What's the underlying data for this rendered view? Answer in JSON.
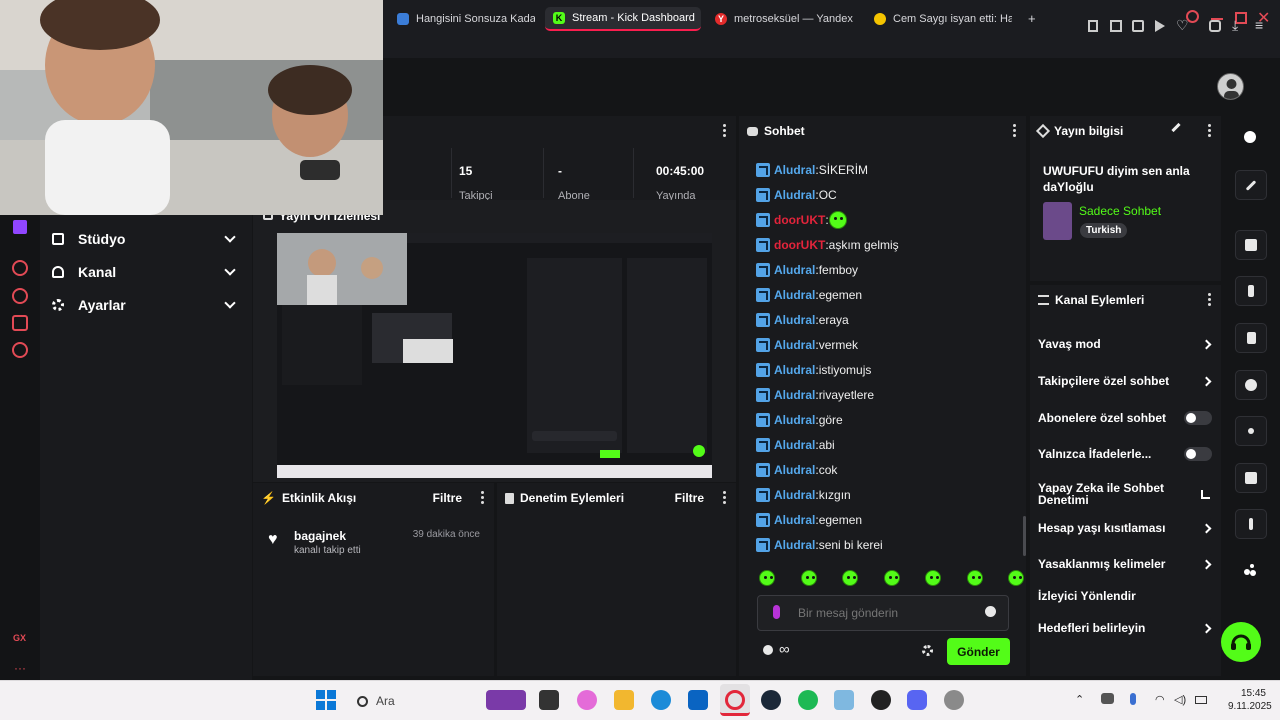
{
  "browser": {
    "tabs": [
      {
        "label": "Hangisini Sonsuza Kadar",
        "color": "#3b7dd8"
      },
      {
        "label": "Stream - Kick Dashboard",
        "color": "#53fc18"
      },
      {
        "label": "metroseksüel — Yandex",
        "color": "#e32b2b"
      },
      {
        "label": "Cem Saygı isyan etti: Hay",
        "color": "#f5c400"
      }
    ],
    "new_tab": "+"
  },
  "leftnav": {
    "items": [
      {
        "label": "Stüdyo"
      },
      {
        "label": "Kanal"
      },
      {
        "label": "Ayarlar"
      }
    ],
    "footer": "GX"
  },
  "stats": {
    "values": [
      "15",
      "-",
      "00:45:00"
    ],
    "labels": [
      "Takipçi",
      "Abone",
      "Yayında"
    ]
  },
  "preview": {
    "title": "Yayın Ön İzlemesi"
  },
  "activity": {
    "title": "Etkinlik Akışı",
    "filter": "Filtre",
    "item": {
      "user": "bagajnek",
      "text": "kanalı takip etti",
      "time": "39 dakika önce"
    }
  },
  "moderation": {
    "title": "Denetim Eylemleri",
    "filter": "Filtre"
  },
  "chat": {
    "title": "Sohbet",
    "messages": [
      {
        "user": "Aludral",
        "text": "SİKERİM",
        "color": "blue"
      },
      {
        "user": "Aludral",
        "text": "OC",
        "color": "blue"
      },
      {
        "user": "doorUKT",
        "text": "",
        "color": "red",
        "emote": true
      },
      {
        "user": "doorUKT",
        "text": "aşkım gelmiş",
        "color": "red"
      },
      {
        "user": "Aludral",
        "text": "femboy",
        "color": "blue"
      },
      {
        "user": "Aludral",
        "text": "egemen",
        "color": "blue"
      },
      {
        "user": "Aludral",
        "text": "eraya",
        "color": "blue"
      },
      {
        "user": "Aludral",
        "text": "vermek",
        "color": "blue"
      },
      {
        "user": "Aludral",
        "text": "istiyomujs",
        "color": "blue"
      },
      {
        "user": "Aludral",
        "text": "rivayetlere",
        "color": "blue"
      },
      {
        "user": "Aludral",
        "text": "göre",
        "color": "blue"
      },
      {
        "user": "Aludral",
        "text": "abi",
        "color": "blue"
      },
      {
        "user": "Aludral",
        "text": "cok",
        "color": "blue"
      },
      {
        "user": "Aludral",
        "text": "kızgın",
        "color": "blue"
      },
      {
        "user": "Aludral",
        "text": "egemen",
        "color": "blue"
      },
      {
        "user": "Aludral",
        "text": "seni bi kerei",
        "color": "blue"
      }
    ],
    "placeholder": "Bir mesaj gönderin",
    "send": "Gönder"
  },
  "stream_info": {
    "title": "Yayın bilgisi",
    "stream_title": "UWUFUFU diyim sen anla daYloğlu",
    "category": "Sadece Sohbet",
    "language": "Turkish"
  },
  "channel_actions": {
    "title": "Kanal Eylemleri",
    "items": [
      {
        "label": "Yavaş mod",
        "control": "chevron"
      },
      {
        "label": "Takipçilere özel sohbet",
        "control": "chevron"
      },
      {
        "label": "Abonelere özel sohbet",
        "control": "toggle"
      },
      {
        "label": "Yalnızca İfadelerle...",
        "control": "toggle"
      },
      {
        "label": "Yapay Zeka ile Sohbet Denetimi",
        "control": "external"
      },
      {
        "label": "Hesap yaşı kısıtlaması",
        "control": "chevron"
      },
      {
        "label": "Yasaklanmış kelimeler",
        "control": "chevron"
      },
      {
        "label": "İzleyici Yönlendir",
        "control": "none"
      },
      {
        "label": "Hedefleri belirleyin",
        "control": "chevron"
      }
    ]
  },
  "taskbar": {
    "search": "Ara",
    "time": "15:45",
    "date": "9.11.2025"
  },
  "colors": {
    "kick_green": "#53fc18",
    "accent_red": "#fa1e4e"
  }
}
